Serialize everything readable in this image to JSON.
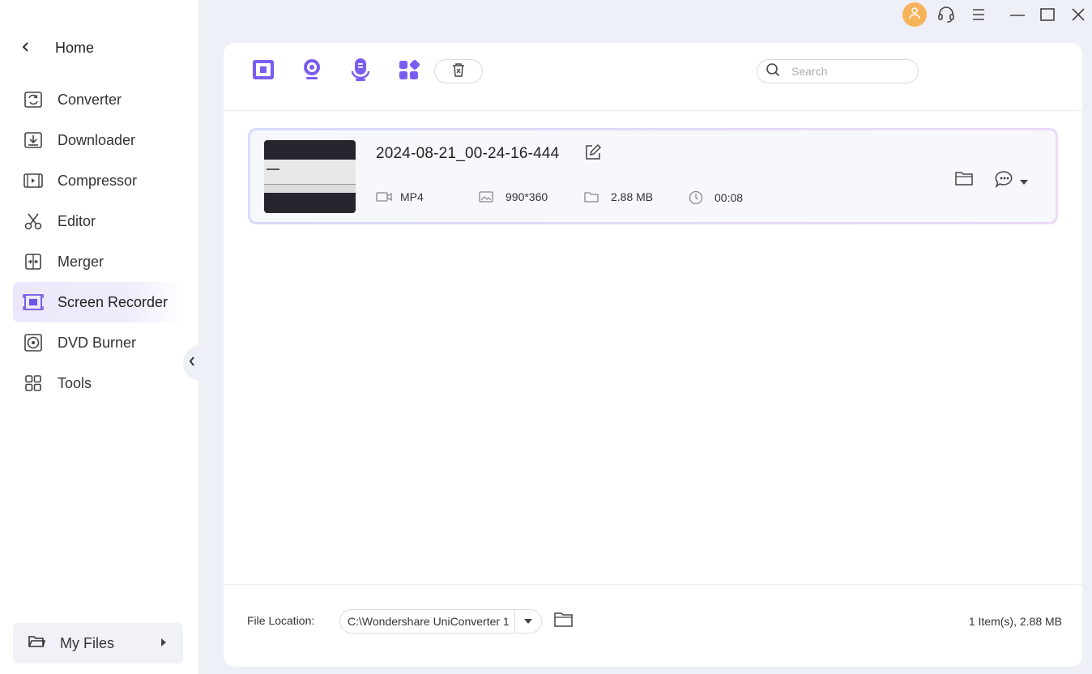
{
  "sidebar": {
    "home_label": "Home",
    "items": [
      {
        "label": "Converter",
        "icon": "converter-icon"
      },
      {
        "label": "Downloader",
        "icon": "downloader-icon"
      },
      {
        "label": "Compressor",
        "icon": "compressor-icon"
      },
      {
        "label": "Editor",
        "icon": "scissors-icon"
      },
      {
        "label": "Merger",
        "icon": "merger-icon"
      },
      {
        "label": "Screen Recorder",
        "icon": "screen-recorder-icon",
        "active": true
      },
      {
        "label": "DVD Burner",
        "icon": "dvd-icon"
      },
      {
        "label": "Tools",
        "icon": "tools-icon"
      }
    ],
    "my_files_label": "My Files"
  },
  "toolbar": {
    "search_placeholder": "Search"
  },
  "file": {
    "name": "2024-08-21_00-24-16-444",
    "format": "MP4",
    "resolution": "990*360",
    "size": "2.88 MB",
    "duration": "00:08"
  },
  "footer": {
    "location_label": "File Location:",
    "location_value": "C:\\Wondershare UniConverter 1",
    "summary": "1 Item(s), 2.88 MB"
  },
  "colors": {
    "accent": "#7b5cf0",
    "avatar": "#f7b35b",
    "active_bg": "#ece6fb"
  }
}
